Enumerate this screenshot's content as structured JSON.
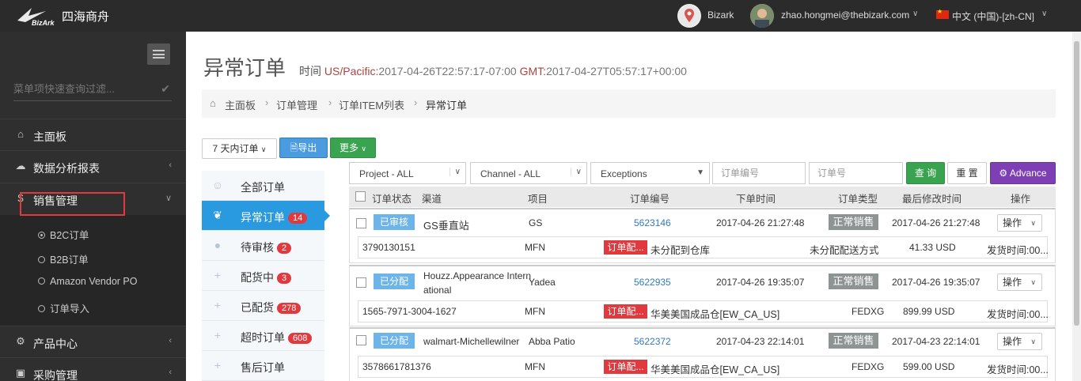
{
  "brand": {
    "name": "四海商舟",
    "mark": "BizArk"
  },
  "topbar": {
    "account": "Bizark",
    "user_email": "zhao.hongmei@thebizark.com",
    "language": "中文 (中国)-[zh-CN]"
  },
  "sidebar": {
    "filter_placeholder": "菜单项快速查询过滤...",
    "items": [
      {
        "label": "主面板",
        "icon": "home-icon"
      },
      {
        "label": "数据分析报表",
        "icon": "cloud-icon"
      },
      {
        "label": "销售管理",
        "icon": "dollar-icon"
      },
      {
        "label": "产品中心",
        "icon": "cogs-icon"
      },
      {
        "label": "采购管理",
        "icon": "cube-icon"
      }
    ],
    "sub_items": [
      "B2C订单",
      "B2B订单",
      "Amazon Vendor PO",
      "订单导入"
    ]
  },
  "page": {
    "title": "异常订单",
    "time_label": "时间",
    "tz1_label": "US/Pacific:",
    "tz1_value": "2017-04-26T22:57:17-07:00",
    "tz2_label": "GMT:",
    "tz2_value": "2017-04-27T05:57:17+00:00"
  },
  "breadcrumb": [
    "主面板",
    "订单管理",
    "订单ITEM列表",
    "异常订单"
  ],
  "toolbar": {
    "range": "7 天内订单",
    "export": "导出",
    "more": "更多"
  },
  "statuses": [
    {
      "label": "全部订单",
      "count": ""
    },
    {
      "label": "异常订单",
      "count": "14"
    },
    {
      "label": "待审核",
      "count": "2"
    },
    {
      "label": "配货中",
      "count": "3"
    },
    {
      "label": "已配货",
      "count": "278"
    },
    {
      "label": "超时订单",
      "count": "608"
    },
    {
      "label": "售后订单",
      "count": ""
    }
  ],
  "filters": {
    "project": "Project - ALL",
    "channel": "Channel - ALL",
    "exceptions": "Exceptions",
    "order_no_placeholder": "订单编号",
    "order_id_placeholder": "订单号",
    "search": "查 询",
    "reset": "重 置",
    "advance": "Advance"
  },
  "table": {
    "headers": [
      "订单状态",
      "渠道",
      "项目",
      "订单编号",
      "下单时间",
      "订单类型",
      "最后修改时间",
      "操作"
    ],
    "rows": [
      {
        "status": "已审核",
        "channel": "GS垂直站",
        "channel2": "",
        "project": "GS",
        "order_no": "5623146",
        "order_time": "2017-04-26 21:27:48",
        "type": "正常销售",
        "modified": "2017-04-26 21:27:48",
        "op": "操作",
        "sub": {
          "ref": "3790130151",
          "fulfil": "MFN",
          "tag": "订单配...",
          "warehouse": "未分配到仓库",
          "ship": "未分配配送方式",
          "amount": "41.33 USD",
          "ship_time": "发货时间:00..."
        }
      },
      {
        "status": "已分配",
        "channel": "Houzz.Appearance Intern",
        "channel2": "ational",
        "project": "Yadea",
        "order_no": "5622935",
        "order_time": "2017-04-26 19:35:07",
        "type": "正常销售",
        "modified": "2017-04-26 19:35:07",
        "op": "操作",
        "sub": {
          "ref": "1565-7971-3004-1627",
          "fulfil": "MFN",
          "tag": "订单配...",
          "warehouse": "华美美国成品仓[EW_CA_US]",
          "ship": "FEDXG",
          "amount": "899.99 USD",
          "ship_time": "发货时间:00..."
        }
      },
      {
        "status": "已分配",
        "channel": "walmart-Michellewilner",
        "channel2": "",
        "project": "Abba Patio",
        "order_no": "5622372",
        "order_time": "2017-04-23 22:14:01",
        "type": "正常销售",
        "modified": "2017-04-23 22:14:01",
        "op": "操作",
        "sub": {
          "ref": "3578661781376",
          "fulfil": "MFN",
          "tag": "订单配...",
          "warehouse": "华美美国成品仓[EW_CA_US]",
          "ship": "FEDXG",
          "amount": "599.00 USD",
          "ship_time": "发货时间:00..."
        }
      }
    ]
  }
}
